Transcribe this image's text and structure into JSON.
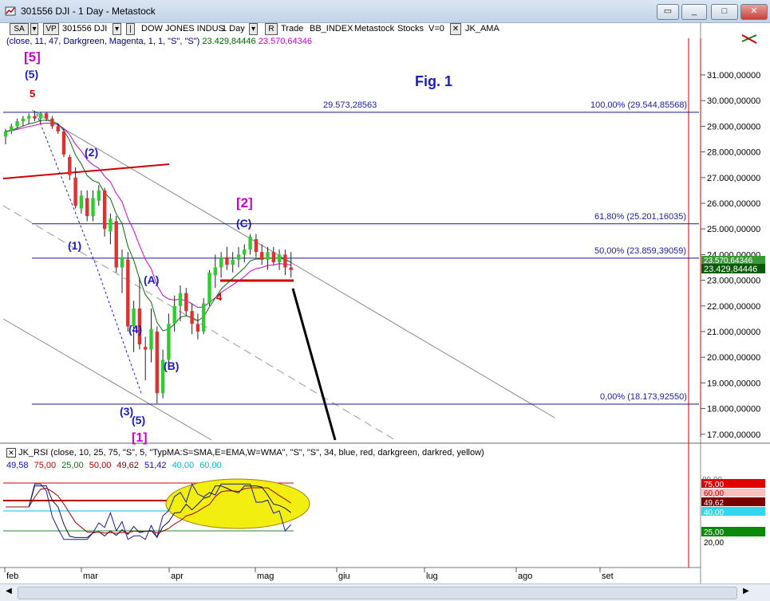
{
  "window": {
    "title": "301556 DJI - 1 Day - Metastock",
    "controls": {
      "min": "_",
      "max": "□",
      "close": "✕"
    }
  },
  "toolbar": {
    "sa": "SA",
    "vp": "VP",
    "symbol": "301556 DJI",
    "security": "DOW JONES INDUS",
    "period": "1 Day",
    "r": "R",
    "trade_label": "Trade",
    "indicator": "BB_INDEX",
    "ms": "Metastock",
    "stocks": "Stocks",
    "v": "V=0",
    "x": "✕",
    "ama": "JK_AMA"
  },
  "ama_line": {
    "params": "(close, 11, 47, Darkgreen, Magenta, 1, 1, \"S\", \"S\")",
    "val1": "23.429,84446",
    "val2": "23.570,64346"
  },
  "annotations": {
    "fig": "Fig. 1",
    "w5_big": "[5]",
    "w5": "(5)",
    "w5_small": "5",
    "w2": "(2)",
    "w1": "(1)",
    "wA": "(A)",
    "w4": "(4)",
    "wB": "(B)",
    "w3": "(3)",
    "w5b": "(5)",
    "w1_big": "[1]",
    "w2_big": "[2]",
    "wC": "(C)",
    "w4_small": "4"
  },
  "fib": {
    "top_price": "29.573,28563",
    "l100": "100,00% (29.544,85568)",
    "l618": "61,80% (25.201,16035)",
    "l50": "50,00% (23.859,39059)",
    "l0": "0,00% (18.173,92550)"
  },
  "price_axis": {
    "ticks": [
      "31.000,00000",
      "30.000,00000",
      "29.000,00000",
      "28.000,00000",
      "27.000,00000",
      "26.000,00000",
      "25.000,00000",
      "24.000,00000",
      "23.000,00000",
      "22.000,00000",
      "21.000,00000",
      "20.000,00000",
      "19.000,00000",
      "18.000,00000",
      "17.000,00000"
    ],
    "badge_close": "23.429,84446",
    "badge_ama": "23.570,64346"
  },
  "rsi": {
    "header": "(close, 10, 25, 75, \"S\", 5, \"TypMA:S=SMA,E=EMA,W=WMA\", \"S\", \"S\", 34, blue, red, darkgreen, darkred, yellow)",
    "name": "JK_RSI",
    "values": [
      {
        "v": "49,58",
        "c": "#1010c0"
      },
      {
        "v": "75,00",
        "c": "#d00000"
      },
      {
        "v": "25,00",
        "c": "#107010"
      },
      {
        "v": "50,00",
        "c": "#a00000"
      },
      {
        "v": "49,62",
        "c": "#800000"
      },
      {
        "v": "51,42",
        "c": "#1010c0"
      },
      {
        "v": "40,00",
        "c": "#00b8d0"
      },
      {
        "v": "60,00",
        "c": "#00b8d0"
      }
    ],
    "axis": {
      "t80": "80,00",
      "t75": "75,00",
      "t60": "60,00",
      "t50": "49,62",
      "t40": "40,00",
      "t25": "25,00",
      "t20": "20,00"
    }
  },
  "date_axis": [
    "feb",
    "mar",
    "apr",
    "mag",
    "giu",
    "lug",
    "ago",
    "set"
  ],
  "chart_data": {
    "type": "candlestick",
    "title": "",
    "y_unit": "index points",
    "ylim": [
      16500,
      31700
    ],
    "grid": false,
    "series": [
      {
        "name": "DOW JONES INDUS",
        "ohlc": [
          [
            "feb",
            28600,
            28900,
            28300,
            28800
          ],
          [
            "",
            28800,
            29100,
            28700,
            29000
          ],
          [
            "",
            29000,
            29300,
            28900,
            29200
          ],
          [
            "",
            29200,
            29400,
            29000,
            29300
          ],
          [
            "",
            29300,
            29500,
            29100,
            29400
          ],
          [
            "",
            29400,
            29600,
            29200,
            29300
          ],
          [
            "",
            29300,
            29560,
            29100,
            29500
          ],
          [
            "",
            29500,
            29560,
            29200,
            29300
          ],
          [
            "",
            29300,
            29400,
            28900,
            29000
          ],
          [
            "",
            29000,
            29100,
            28700,
            28800
          ],
          [
            "",
            28800,
            28900,
            27800,
            27900
          ],
          [
            "",
            27800,
            27900,
            26900,
            27100
          ],
          [
            "mar",
            27000,
            27400,
            25800,
            25900
          ],
          [
            "",
            25800,
            26500,
            25600,
            26300
          ],
          [
            "",
            26200,
            26500,
            25300,
            25500
          ],
          [
            "",
            25500,
            26500,
            25300,
            26200
          ],
          [
            "",
            26100,
            26700,
            25900,
            26500
          ],
          [
            "",
            26500,
            26600,
            24700,
            25000
          ],
          [
            "",
            24900,
            25600,
            24400,
            25400
          ],
          [
            "",
            25300,
            25500,
            23300,
            23500
          ],
          [
            "",
            23500,
            24200,
            22500,
            23900
          ],
          [
            "",
            23800,
            24100,
            21000,
            21200
          ],
          [
            "",
            21200,
            22200,
            20200,
            21900
          ],
          [
            "",
            21900,
            23100,
            20300,
            20500
          ],
          [
            "",
            20400,
            20800,
            19100,
            20300
          ],
          [
            "",
            20300,
            21900,
            19800,
            21100
          ],
          [
            "",
            21000,
            21200,
            18200,
            18600
          ],
          [
            "",
            18600,
            20300,
            18400,
            19900
          ],
          [
            "",
            19900,
            21700,
            19600,
            21300
          ],
          [
            "apr",
            21300,
            22400,
            21000,
            22000
          ],
          [
            "",
            22000,
            22800,
            21400,
            22500
          ],
          [
            "",
            22500,
            22700,
            21600,
            21800
          ],
          [
            "",
            21800,
            22100,
            20900,
            21300
          ],
          [
            "",
            21300,
            21700,
            20700,
            21000
          ],
          [
            "",
            21000,
            22300,
            20900,
            22100
          ],
          [
            "",
            22100,
            23400,
            22000,
            23300
          ],
          [
            "",
            23200,
            24000,
            22700,
            23500
          ],
          [
            "",
            23500,
            24100,
            23100,
            23900
          ],
          [
            "",
            23900,
            24300,
            23400,
            23600
          ],
          [
            "",
            23600,
            24100,
            23300,
            23800
          ],
          [
            "",
            23800,
            24300,
            23500,
            24000
          ],
          [
            "",
            24000,
            24400,
            23700,
            24200
          ],
          [
            "mag",
            24200,
            24800,
            24000,
            24700
          ],
          [
            "",
            24600,
            24800,
            23900,
            24100
          ],
          [
            "",
            24100,
            24400,
            23600,
            23800
          ],
          [
            "",
            23800,
            24300,
            23400,
            24100
          ],
          [
            "",
            24100,
            24300,
            23600,
            23700
          ],
          [
            "",
            23700,
            24200,
            23400,
            24000
          ],
          [
            "",
            24000,
            24200,
            23200,
            23500
          ],
          [
            "",
            23500,
            24100,
            23100,
            23400
          ]
        ]
      }
    ],
    "fibonacci": [
      {
        "level": "100,00%",
        "price": 29544.85568
      },
      {
        "level": "61,80%",
        "price": 25201.16035
      },
      {
        "level": "50,00%",
        "price": 23859.39059
      },
      {
        "level": "0,00%",
        "price": 18173.9255
      }
    ],
    "rsi_ylim": [
      15,
      85
    ]
  }
}
